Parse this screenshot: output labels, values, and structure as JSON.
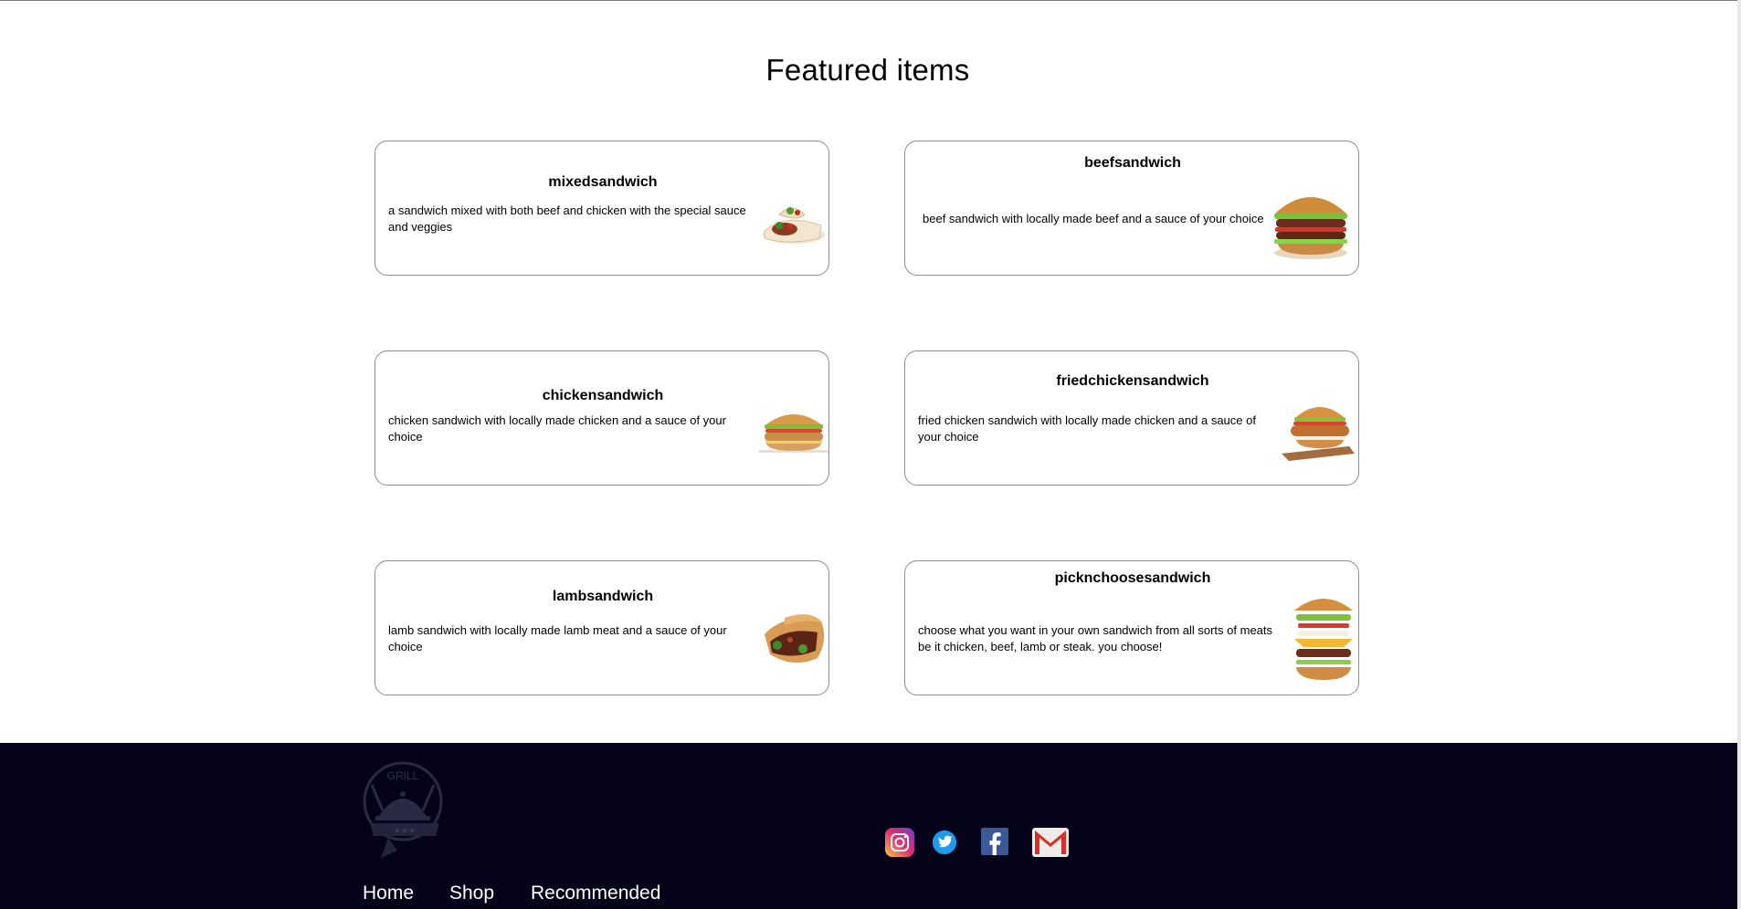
{
  "heading": "Featured items",
  "items": [
    {
      "name": "mixedsandwich",
      "description": "a sandwich mixed with both beef and chicken with the special sauce and veggies",
      "image": "wrap-sandwich-image"
    },
    {
      "name": "beefsandwich",
      "description": "beef sandwich with locally made beef and a sauce of your choice",
      "image": "beef-burger-image"
    },
    {
      "name": "chickensandwich",
      "description": "chicken sandwich with locally made chicken and a sauce of your choice",
      "image": "chicken-burger-image"
    },
    {
      "name": "friedchickensandwich",
      "description": "fried chicken sandwich with locally made chicken and a sauce of your choice",
      "image": "fried-chicken-burger-image"
    },
    {
      "name": "lambsandwich",
      "description": "lamb sandwich with locally made lamb meat and a sauce of your choice",
      "image": "lamb-pita-image"
    },
    {
      "name": "picknchoosesandwich",
      "description": "choose what you want in your own sandwich from all sorts of meats be it chicken, beef, lamb or steak. you choose!",
      "image": "stacked-burger-image"
    }
  ],
  "footer": {
    "logo_text": "GRILL",
    "nav": [
      {
        "label": "Home"
      },
      {
        "label": "Shop"
      },
      {
        "label": "Recommended"
      }
    ],
    "social_icons": [
      "instagram-icon",
      "twitter-icon",
      "facebook-icon",
      "gmail-icon"
    ]
  },
  "colors": {
    "footer_bg": "#05031a",
    "card_border": "#8d8d8d",
    "footer_text": "#ffffff"
  }
}
